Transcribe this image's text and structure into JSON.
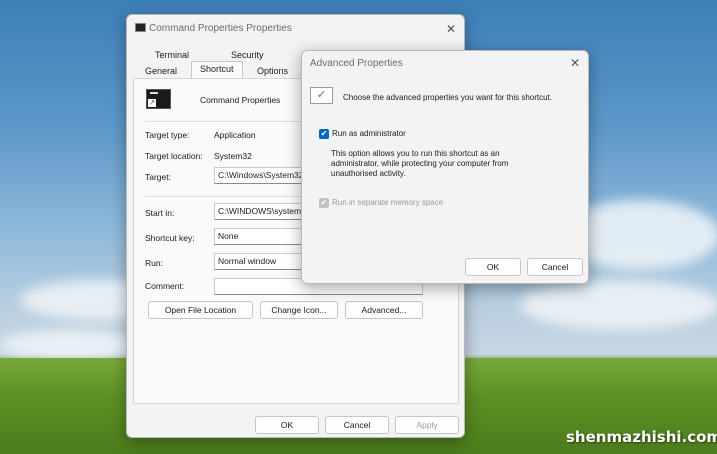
{
  "main_window": {
    "title": "Command Properties Properties",
    "tabs_back": [
      "Terminal",
      "Security"
    ],
    "tabs_front": [
      "General",
      "Shortcut",
      "Options"
    ],
    "active_tab": "Shortcut",
    "shortcut_name": "Command Properties",
    "target_type_label": "Target type:",
    "target_type_value": "Application",
    "target_location_label": "Target location:",
    "target_location_value": "System32",
    "target_label": "Target:",
    "target_value": "C:\\Windows\\System32\\cmd.exe",
    "start_in_label": "Start in:",
    "start_in_value": "C:\\WINDOWS\\system32",
    "shortcut_key_label": "Shortcut key:",
    "shortcut_key_value": "None",
    "run_label": "Run:",
    "run_value": "Normal window",
    "comment_label": "Comment:",
    "comment_value": "",
    "open_file_location": "Open File Location",
    "change_icon": "Change Icon...",
    "advanced": "Advanced...",
    "ok": "OK",
    "cancel": "Cancel",
    "apply": "Apply"
  },
  "advanced_window": {
    "title": "Advanced Properties",
    "header_text": "Choose the advanced properties you want for this shortcut.",
    "run_as_admin_label": "Run as administrator",
    "run_as_admin_checked": true,
    "description": "This option allows you to run this shortcut as an administrator, while protecting your computer from unauthorised activity.",
    "separate_memory_label": "Run in separate memory space",
    "ok": "OK",
    "cancel": "Cancel"
  },
  "icons": {
    "close": "✕",
    "check": "✓",
    "checkbox_check": "✔"
  },
  "watermark": "shenmazhishi.com"
}
